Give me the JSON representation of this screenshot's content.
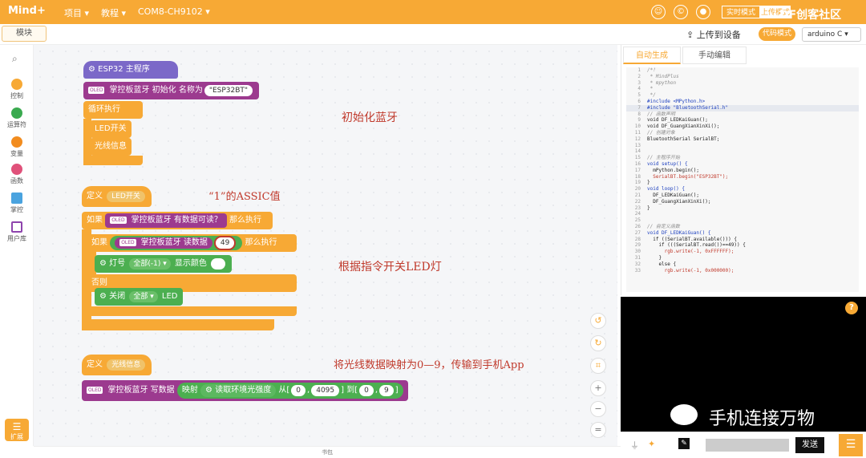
{
  "topbar": {
    "logo": "Mind+",
    "menu_project": "项目 ▾",
    "menu_tutorial": "教程 ▾",
    "menu_port": "COM8-CH9102 ▾",
    "mode_realtime": "实时模式",
    "mode_upload": "上传模式",
    "watermark_top": "DF创客社区"
  },
  "toolbar": {
    "blocks_tab": "模块",
    "upload_label": "上传到设备",
    "code_label": "代码模式",
    "board": "arduino C ▾"
  },
  "sidebar": {
    "items": [
      {
        "label": "控制",
        "color": "#f7a935"
      },
      {
        "label": "运算符",
        "color": "#3aaa4f"
      },
      {
        "label": "变量",
        "color": "#f28c1f"
      },
      {
        "label": "函数",
        "color": "#e0517a"
      },
      {
        "label": "掌控",
        "color": "#4aa3df"
      },
      {
        "label": "用户库",
        "color": "#8e44ad"
      }
    ],
    "extension": "扩展"
  },
  "blocks": {
    "main_hat": "ESP32 主程序",
    "bt_init": "掌控板蓝牙 初始化 名称为",
    "bt_name": "\"ESP32BT\"",
    "loop": "循环执行",
    "call_led": "LED开关",
    "call_light": "光线信息",
    "def1_label": "定义",
    "def1_name": "LED开关",
    "if_label": "如果",
    "bt_available": "掌控板蓝牙 有数据可读？",
    "then_label": "那么执行",
    "bt_read": "掌控板蓝牙 读数据",
    "eq_value": "49",
    "rgb_label": "灯号",
    "rgb_all": "全部(-1) ▾",
    "rgb_color": "显示颜色",
    "else_label": "否则",
    "off_label": "关闭",
    "off_all": "全部 ▾",
    "off_led": "LED",
    "def2_label": "定义",
    "def2_name": "光线信息",
    "bt_write": "掌控板蓝牙 写数据",
    "map_label": "映射",
    "read_light": "读取环境光强度",
    "from_label": "从[",
    "from_min": "0",
    "from_max": "4095",
    "to_label": "] 到[",
    "to_min": "0",
    "to_max": "9",
    "close_bracket": "]"
  },
  "annotations": {
    "a1": "初始化蓝牙",
    "a2": "“1”的ASSIC值",
    "a3": "根据指令开关LED灯",
    "a4": "将光线数据映射为0—9，传输到手机App"
  },
  "code_panel": {
    "tab_auto": "自动生成",
    "tab_manual": "手动编辑",
    "lines": [
      {
        "n": "1",
        "t": "/*!",
        "c": "c-cm"
      },
      {
        "n": "2",
        "t": " * MindPlus",
        "c": "c-cm"
      },
      {
        "n": "3",
        "t": " * mpython",
        "c": "c-cm"
      },
      {
        "n": "4",
        "t": " *",
        "c": "c-cm"
      },
      {
        "n": "5",
        "t": " */",
        "c": "c-cm"
      },
      {
        "n": "6",
        "t": "#include <MPython.h>",
        "c": "c-kw"
      },
      {
        "n": "7",
        "t": "#include \"BluetoothSerial.h\"",
        "c": "c-kw"
      },
      {
        "n": "8",
        "t": "// 函数声明",
        "c": "c-cm"
      },
      {
        "n": "9",
        "t": "void DF_LEDKaiGuan();",
        "c": "c-tx"
      },
      {
        "n": "10",
        "t": "void DF_GuangXianXinXi();",
        "c": "c-tx"
      },
      {
        "n": "11",
        "t": "// 创建对象",
        "c": "c-cm"
      },
      {
        "n": "12",
        "t": "BluetoothSerial SerialBT;",
        "c": "c-tx"
      },
      {
        "n": "13",
        "t": "",
        "c": "c-tx"
      },
      {
        "n": "14",
        "t": "",
        "c": "c-tx"
      },
      {
        "n": "15",
        "t": "// 主程序开始",
        "c": "c-cm"
      },
      {
        "n": "16",
        "t": "void setup() {",
        "c": "c-kw"
      },
      {
        "n": "17",
        "t": "  mPython.begin();",
        "c": "c-tx"
      },
      {
        "n": "18",
        "t": "  SerialBT.begin(\"ESP32BT\");",
        "c": "c-str"
      },
      {
        "n": "19",
        "t": "}",
        "c": "c-tx"
      },
      {
        "n": "20",
        "t": "void loop() {",
        "c": "c-kw"
      },
      {
        "n": "21",
        "t": "  DF_LEDKaiGuan();",
        "c": "c-tx"
      },
      {
        "n": "22",
        "t": "  DF_GuangXianXinXi();",
        "c": "c-tx"
      },
      {
        "n": "23",
        "t": "}",
        "c": "c-tx"
      },
      {
        "n": "24",
        "t": "",
        "c": "c-tx"
      },
      {
        "n": "25",
        "t": "",
        "c": "c-tx"
      },
      {
        "n": "26",
        "t": "// 自定义函数",
        "c": "c-cm"
      },
      {
        "n": "27",
        "t": "void DF_LEDKaiGuan() {",
        "c": "c-kw"
      },
      {
        "n": "28",
        "t": "  if ((SerialBT.available())) {",
        "c": "c-tx"
      },
      {
        "n": "29",
        "t": "    if (((SerialBT.read())==49)) {",
        "c": "c-tx"
      },
      {
        "n": "30",
        "t": "      rgb.write(-1, 0xFFFFFF);",
        "c": "c-str"
      },
      {
        "n": "31",
        "t": "    }",
        "c": "c-tx"
      },
      {
        "n": "32",
        "t": "    else {",
        "c": "c-tx"
      },
      {
        "n": "33",
        "t": "      rgb.write(-1, 0x000000);",
        "c": "c-str"
      }
    ]
  },
  "serial": {
    "watermark": "手机连接万物",
    "send": "发送",
    "help": "?"
  },
  "bottom": {
    "label": "书包"
  }
}
